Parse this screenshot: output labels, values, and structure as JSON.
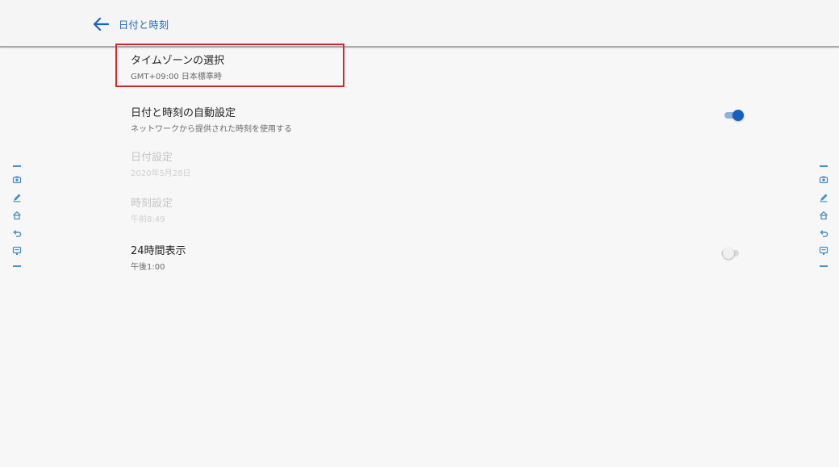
{
  "appbar": {
    "title": "日付と時刻",
    "back_icon": "arrow-left-icon"
  },
  "settings": {
    "timezone": {
      "title": "タイムゾーンの選択",
      "summary": "GMT+09:00 日本標準時"
    },
    "auto_datetime": {
      "title": "日付と時刻の自動設定",
      "summary": "ネットワークから提供された時刻を使用する",
      "enabled": true
    },
    "date": {
      "title": "日付設定",
      "summary": "2020年5月28日"
    },
    "time": {
      "title": "時刻設定",
      "summary": "午前8:49"
    },
    "hour24": {
      "title": "24時間表示",
      "summary": "午後1:00",
      "enabled": false
    }
  },
  "side_toolbar": {
    "icons": [
      "screenshot-icon",
      "pen-icon",
      "home-icon",
      "back-icon",
      "menu-icon"
    ]
  },
  "colors": {
    "accent": "#1460c2",
    "highlight_border": "#d8252a",
    "side_icon": "#4a90c9"
  }
}
